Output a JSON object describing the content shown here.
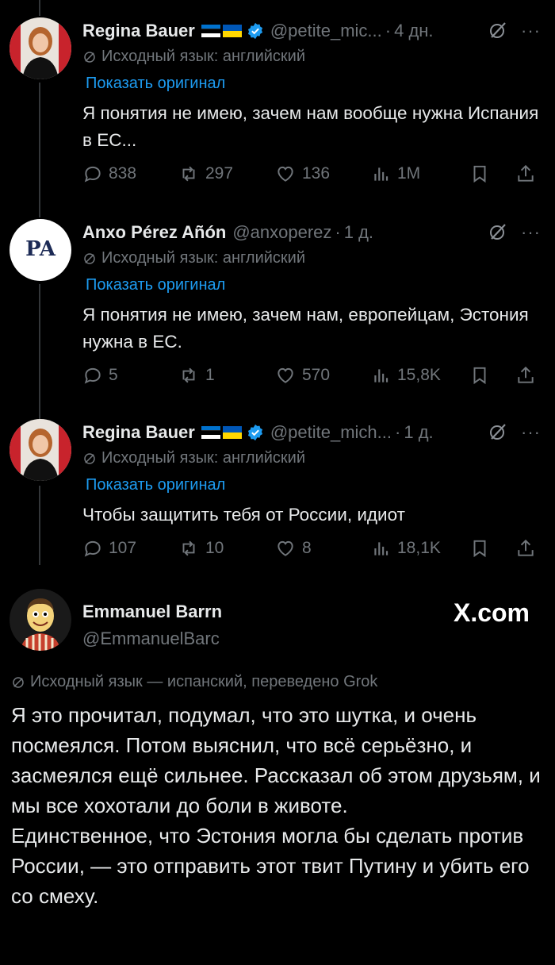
{
  "tweets": [
    {
      "name": "Regina Bauer",
      "handle": "@petite_mic...",
      "time": "4 дн.",
      "source_lang": "Исходный язык: английский",
      "show_original": "Показать оригинал",
      "text": "Я понятия не имею, зачем нам вообще нужна Испания в ЕС...",
      "stats": {
        "replies": "838",
        "reposts": "297",
        "likes": "136",
        "views": "1M"
      }
    },
    {
      "name": "Anxo Pérez Añón",
      "handle": "@anxoperez",
      "time": "1 д.",
      "source_lang": "Исходный язык: английский",
      "show_original": "Показать оригинал",
      "text": "Я понятия не имею, зачем нам, европейцам, Эстония нужна в ЕС.",
      "stats": {
        "replies": "5",
        "reposts": "1",
        "likes": "570",
        "views": "15,8K"
      }
    },
    {
      "name": "Regina Bauer",
      "handle": "@petite_mich...",
      "time": "1 д.",
      "source_lang": "Исходный язык: английский",
      "show_original": "Показать оригинал",
      "text": "Чтобы защитить тебя от России, идиот",
      "stats": {
        "replies": "107",
        "reposts": "10",
        "likes": "8",
        "views": "18,1K"
      }
    }
  ],
  "featured": {
    "name": "Emmanuel Barrn",
    "handle": "@EmmanuelBarc",
    "watermark": "X.com",
    "source_lang": "Исходный язык — испанский, переведено Grok",
    "paragraph1": "Я это прочитал, подумал, что это шутка, и очень посмеялся. Потом выяснил, что всё серьёзно, и засмеялся ещё сильнее. Рассказал об этом друзьям, и мы все хохотали до боли в животе.",
    "paragraph2": "Единственное, что Эстония могла бы сделать против России, — это отправить этот твит Путину и убить его со смеху."
  },
  "colors": {
    "background": "#000000",
    "text": "#e7e9ea",
    "muted": "#71767b",
    "link": "#1d9bf0",
    "verified": "#1d9bf0"
  },
  "icons": [
    "reply-icon",
    "repost-icon",
    "like-icon",
    "views-icon",
    "bookmark-icon",
    "share-icon",
    "grok-icon",
    "more-icon",
    "verified-icon",
    "translate-icon"
  ]
}
